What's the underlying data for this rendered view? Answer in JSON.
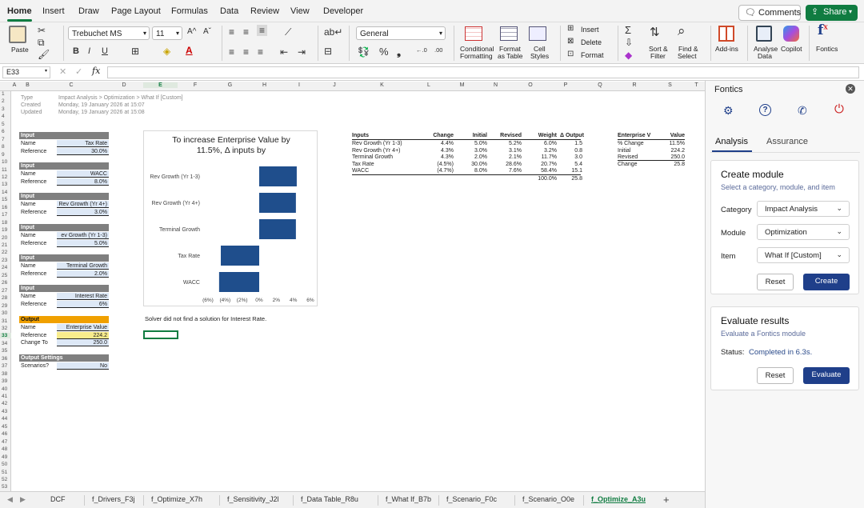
{
  "ribbon_tabs": [
    "Home",
    "Insert",
    "Draw",
    "Page Layout",
    "Formulas",
    "Data",
    "Review",
    "View",
    "Developer"
  ],
  "comments_label": "Comments",
  "share_label": "Share",
  "ribbon": {
    "paste": "Paste",
    "font_name": "Trebuchet MS",
    "font_size": "11",
    "number_format": "General",
    "cond_format": [
      "Conditional",
      "Formatting"
    ],
    "format_table": [
      "Format",
      "as Table"
    ],
    "cell_styles": [
      "Cell",
      "Styles"
    ],
    "insert": "Insert",
    "delete": "Delete",
    "format": "Format",
    "sort_filter": [
      "Sort &",
      "Filter"
    ],
    "find_select": [
      "Find &",
      "Select"
    ],
    "addins": "Add-ins",
    "analyse": [
      "Analyse",
      "Data"
    ],
    "copilot": "Copilot",
    "fontics": "Fontics"
  },
  "formula_bar": {
    "cell_ref": "E33",
    "fx": "fx",
    "value": ""
  },
  "columns": [
    "A",
    "B",
    "C",
    "D",
    "E",
    "F",
    "G",
    "H",
    "I",
    "J",
    "K",
    "L",
    "M",
    "N",
    "O",
    "P",
    "Q",
    "R",
    "S",
    "T"
  ],
  "rows": [
    "1",
    "2",
    "3",
    "4",
    "5",
    "6",
    "7",
    "8",
    "9",
    "10",
    "11",
    "12",
    "13",
    "14",
    "15",
    "16",
    "17",
    "18",
    "19",
    "20",
    "21",
    "22",
    "23",
    "24",
    "25",
    "26",
    "27",
    "28",
    "29",
    "30",
    "31",
    "32",
    "33",
    "34",
    "35",
    "36",
    "37",
    "38",
    "39",
    "40",
    "41",
    "42",
    "43",
    "44",
    "45",
    "46",
    "47",
    "48",
    "49",
    "50",
    "51",
    "52",
    "53"
  ],
  "meta": [
    {
      "label": "Type",
      "value": "Impact Analysis > Optimization > What If [Custom]"
    },
    {
      "label": "Created",
      "value": "Monday, 19 January 2026 at 15:07"
    },
    {
      "label": "Updated",
      "value": "Monday, 19 January 2026 at 15:08"
    }
  ],
  "inputs": [
    {
      "header": "Input",
      "name_label": "Name",
      "name": "Tax Rate",
      "ref_label": "Reference",
      "ref": "30.0%"
    },
    {
      "header": "Input",
      "name_label": "Name",
      "name": "WACC",
      "ref_label": "Reference",
      "ref": "8.0%"
    },
    {
      "header": "Input",
      "name_label": "Name",
      "name": "Rev Growth (Yr 4+)",
      "ref_label": "Reference",
      "ref": "3.0%"
    },
    {
      "header": "Input",
      "name_label": "Name",
      "name": "ev Growth (Yr 1-3)",
      "ref_label": "Reference",
      "ref": "5.0%"
    },
    {
      "header": "Input",
      "name_label": "Name",
      "name": "Terminal Growth",
      "ref_label": "Reference",
      "ref": "2.0%"
    },
    {
      "header": "Input",
      "name_label": "Name",
      "name": "Interest Rate",
      "ref_label": "Reference",
      "ref": "6%"
    }
  ],
  "output": {
    "header": "Output",
    "name_label": "Name",
    "name": "Enterprise Value",
    "ref_label": "Reference",
    "ref": "224.2",
    "change_label": "Change To",
    "change": "250.0"
  },
  "output_settings": {
    "header": "Output Settings",
    "label": "Scenarios?",
    "value": "No"
  },
  "solver_msg": "Solver did not find a solution for Interest Rate.",
  "chart_data": {
    "type": "bar",
    "orientation": "horizontal",
    "title": "To increase Enterprise Value by 11.5%, Δ inputs by",
    "categories": [
      "Rev Growth (Yr 1-3)",
      "Rev Growth (Yr 4+)",
      "Terminal Growth",
      "Tax Rate",
      "WACC"
    ],
    "values": [
      4.4,
      4.3,
      4.3,
      -4.5,
      -4.7
    ],
    "xlim": [
      -6,
      6
    ],
    "xticks": [
      "(6%)",
      "(4%)",
      "(2%)",
      "0%",
      "2%",
      "4%",
      "6%"
    ],
    "tick_values": [
      -6,
      -4,
      -2,
      0,
      2,
      4,
      6
    ],
    "bar_color": "#1f4e8c"
  },
  "inputs_table": {
    "headers": [
      "Inputs",
      "Change",
      "Initial",
      "Revised",
      "Weight",
      "Δ Output"
    ],
    "rows": [
      [
        "Rev Growth (Yr 1-3)",
        "4.4%",
        "5.0%",
        "5.2%",
        "6.0%",
        "1.5"
      ],
      [
        "Rev Growth (Yr 4+)",
        "4.3%",
        "3.0%",
        "3.1%",
        "3.2%",
        "0.8"
      ],
      [
        "Terminal Growth",
        "4.3%",
        "2.0%",
        "2.1%",
        "11.7%",
        "3.0"
      ],
      [
        "Tax Rate",
        "(4.5%)",
        "30.0%",
        "28.6%",
        "20.7%",
        "5.4"
      ],
      [
        "WACC",
        "(4.7%)",
        "8.0%",
        "7.6%",
        "58.4%",
        "15.1"
      ]
    ],
    "totals": [
      "",
      "",
      "",
      "",
      "100.0%",
      "25.8"
    ]
  },
  "ev_table": {
    "headers": [
      "Enterprise V",
      "Value"
    ],
    "rows": [
      [
        "% Change",
        "11.5%"
      ],
      [
        "Initial",
        "224.2"
      ],
      [
        "Revised",
        "250.0"
      ],
      [
        "Change",
        "25.8"
      ]
    ]
  },
  "sheet_tabs": [
    "DCF",
    "f_Drivers_F3j",
    "f_Optimize_X7h",
    "f_Sensitivity_J2l",
    "f_Data Table_R8u",
    "f_What If_B7b",
    "f_Scenario_F0c",
    "f_Scenario_O0e",
    "f_Optimize_A3u"
  ],
  "active_sheet": "f_Optimize_A3u",
  "panel": {
    "title": "Fontics",
    "tabs": [
      "Analysis",
      "Assurance"
    ],
    "create": {
      "title": "Create module",
      "subtitle": "Select a category, module, and item",
      "category_label": "Category",
      "category": "Impact Analysis",
      "module_label": "Module",
      "module": "Optimization",
      "item_label": "Item",
      "item": "What If [Custom]",
      "reset": "Reset",
      "submit": "Create"
    },
    "evaluate": {
      "title": "Evaluate results",
      "subtitle": "Evaluate a Fontics module",
      "status_label": "Status:",
      "status": "Completed in 6.3s.",
      "reset": "Reset",
      "submit": "Evaluate"
    }
  },
  "colors": {
    "accent": "#107c41",
    "primary_button": "#1f3f8a",
    "bar": "#1f4e8c",
    "header_gray": "#7f7f7f",
    "input_fill": "#dde8f6"
  }
}
